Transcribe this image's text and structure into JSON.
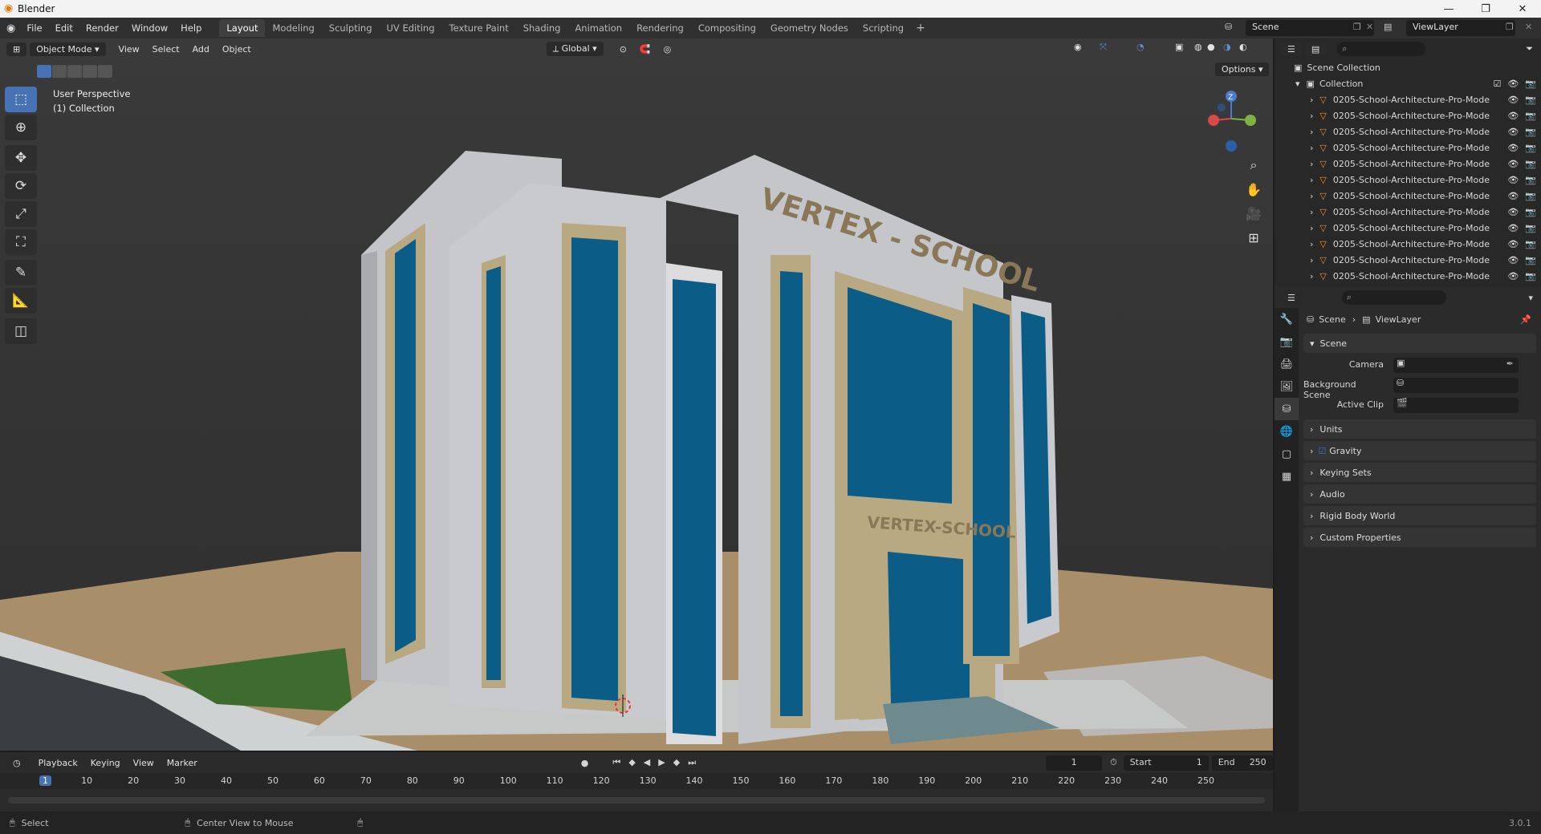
{
  "titlebar": {
    "title": "Blender",
    "minimize": "—",
    "maximize": "❐",
    "close": "✕"
  },
  "menu": [
    "File",
    "Edit",
    "Render",
    "Window",
    "Help"
  ],
  "workspaces": [
    "Layout",
    "Modeling",
    "Sculpting",
    "UV Editing",
    "Texture Paint",
    "Shading",
    "Animation",
    "Rendering",
    "Compositing",
    "Geometry Nodes",
    "Scripting"
  ],
  "active_workspace": "Layout",
  "add_workspace": "+",
  "scene": "Scene",
  "view_layer": "ViewLayer",
  "viewport": {
    "mode": "Object Mode",
    "menus": [
      "View",
      "Select",
      "Add",
      "Object"
    ],
    "orientation": "Global",
    "options_label": "Options",
    "perspective": "User Perspective",
    "collection": "(1) Collection",
    "gizmo_z": "Z",
    "building_sign_top": "VERTEX - SCHOOL",
    "building_sign_entrance": "VERTEX-SCHOOL"
  },
  "outliner": {
    "root": "Scene Collection",
    "collection": "Collection",
    "items": [
      "0205-School-Architecture-Pro-Mode",
      "0205-School-Architecture-Pro-Mode",
      "0205-School-Architecture-Pro-Mode",
      "0205-School-Architecture-Pro-Mode",
      "0205-School-Architecture-Pro-Mode",
      "0205-School-Architecture-Pro-Mode",
      "0205-School-Architecture-Pro-Mode",
      "0205-School-Architecture-Pro-Mode",
      "0205-School-Architecture-Pro-Mode",
      "0205-School-Architecture-Pro-Mode",
      "0205-School-Architecture-Pro-Mode",
      "0205-School-Architecture-Pro-Mode"
    ]
  },
  "properties": {
    "breadcrumb_scene": "Scene",
    "breadcrumb_viewlayer": "ViewLayer",
    "section_scene": "Scene",
    "camera_label": "Camera",
    "background_scene_label": "Background Scene",
    "active_clip_label": "Active Clip",
    "sections": [
      "Units",
      "Gravity",
      "Keying Sets",
      "Audio",
      "Rigid Body World",
      "Custom Properties"
    ]
  },
  "timeline": {
    "menus": [
      "Playback",
      "Keying",
      "View",
      "Marker"
    ],
    "current_frame": "1",
    "start_label": "Start",
    "start": "1",
    "end_label": "End",
    "end": "250",
    "ruler": [
      "1",
      "10",
      "20",
      "30",
      "40",
      "50",
      "60",
      "70",
      "80",
      "90",
      "100",
      "110",
      "120",
      "130",
      "140",
      "150",
      "160",
      "170",
      "180",
      "190",
      "200",
      "210",
      "220",
      "230",
      "240",
      "250"
    ]
  },
  "status": {
    "select": "Select",
    "center_view": "Center View to Mouse",
    "version": "3.0.1"
  },
  "colors": {
    "accent": "#4772b3",
    "glass": "#0b5c86",
    "wall": "#c6c7c9",
    "trim": "#b5a582",
    "ground": "#a88f6a"
  }
}
